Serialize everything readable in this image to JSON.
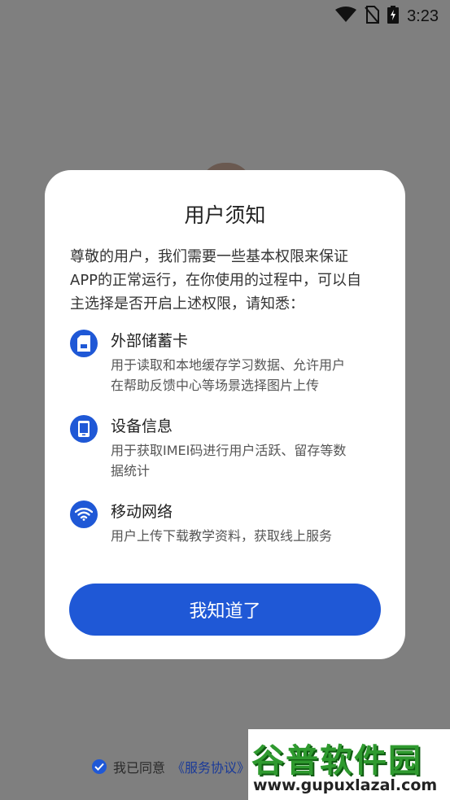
{
  "status_bar": {
    "time": "3:23",
    "icons": [
      "wifi-icon",
      "no-sim-icon",
      "battery-charging-icon"
    ]
  },
  "dialog": {
    "title": "用户须知",
    "intro_lines": [
      "尊敬的用户，我们需要一些基本权限来保证",
      "APP的正常运行，在你使用的过程中，可以自",
      "主选择是否开启上述权限，请知悉："
    ],
    "permissions": [
      {
        "icon": "sd-card-icon",
        "title": "外部储蓄卡",
        "desc_lines": [
          "用于读取和本地缓存学习数据、允许用户",
          "在帮助反馈中心等场景选择图片上传"
        ]
      },
      {
        "icon": "phone-device-icon",
        "title": "设备信息",
        "desc_lines": [
          "用于获取IMEI码进行用户活跃、留存等数",
          "据统计"
        ]
      },
      {
        "icon": "wifi-icon",
        "title": "移动网络",
        "desc_lines": [
          "用户上传下载教学资料，获取线上服务"
        ]
      }
    ],
    "confirm_label": "我知道了"
  },
  "agreement": {
    "prefix": "我已同意",
    "link": "《服务协议》"
  },
  "watermark": {
    "title": "谷普软件园",
    "url": "www.gupuxlazal.com"
  },
  "colors": {
    "accent": "#1f58d6",
    "overlay": "#7f7f7f"
  }
}
